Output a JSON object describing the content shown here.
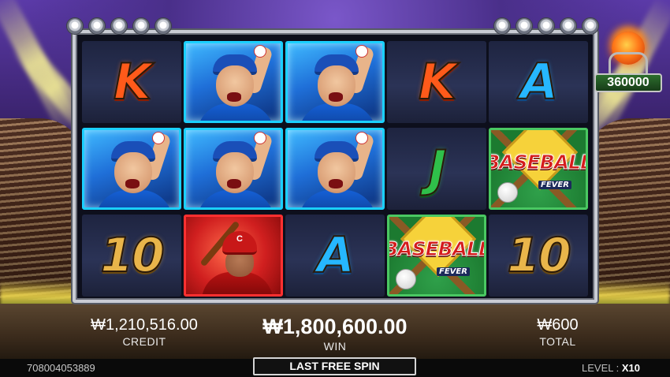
{
  "jackpot": {
    "value": "360000"
  },
  "reels": [
    [
      {
        "type": "letter",
        "text": "K",
        "cls": "K"
      },
      {
        "type": "pitcher"
      },
      {
        "type": "pitcher"
      },
      {
        "type": "letter",
        "text": "K",
        "cls": "K"
      },
      {
        "type": "letter",
        "text": "A",
        "cls": "A"
      }
    ],
    [
      {
        "type": "pitcher"
      },
      {
        "type": "pitcher"
      },
      {
        "type": "pitcher"
      },
      {
        "type": "letter",
        "text": "J",
        "cls": "J"
      },
      {
        "type": "logo",
        "word": "BASEBALL",
        "sub": "FEVER"
      }
    ],
    [
      {
        "type": "letter",
        "text": "10",
        "cls": "ten"
      },
      {
        "type": "batter",
        "helmet": "C"
      },
      {
        "type": "letter",
        "text": "A",
        "cls": "A"
      },
      {
        "type": "logo",
        "word": "BASEBALL",
        "sub": "FEVER"
      },
      {
        "type": "letter",
        "text": "10",
        "cls": "ten"
      }
    ]
  ],
  "credit": {
    "amount": "₩1,210,516.00",
    "label": "CREDIT"
  },
  "win": {
    "amount": "₩1,800,600.00",
    "label": "WIN"
  },
  "total": {
    "amount": "₩600",
    "label": "TOTAL"
  },
  "round_id": "708004053889",
  "spin_status": "LAST FREE SPIN",
  "level": {
    "label": "LEVEL :",
    "value": "X10"
  }
}
